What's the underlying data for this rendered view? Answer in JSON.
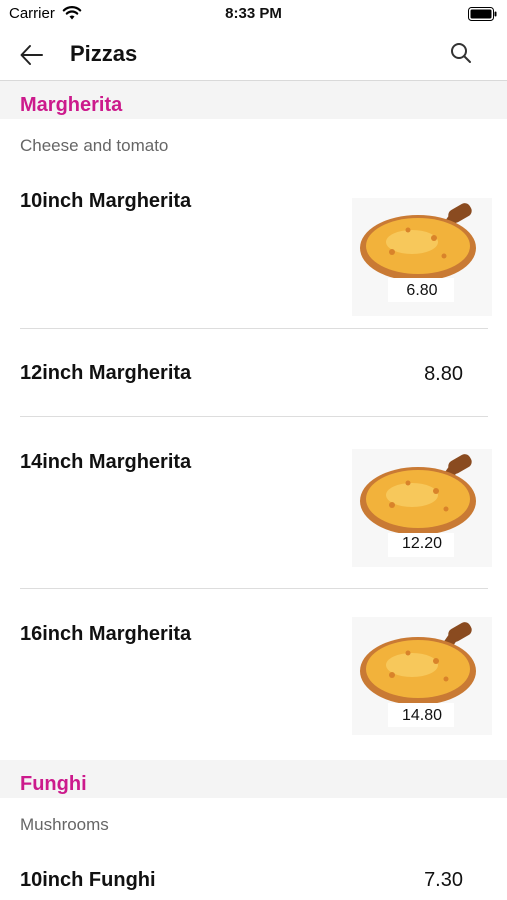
{
  "status_bar": {
    "carrier": "Carrier",
    "time": "8:33 PM"
  },
  "nav": {
    "title": "Pizzas"
  },
  "sections": [
    {
      "title": "Margherita",
      "description": "Cheese and tomato",
      "items": [
        {
          "name": "10inch Margherita",
          "price": "6.80",
          "has_image": true
        },
        {
          "name": "12inch Margherita",
          "price": "8.80",
          "has_image": false
        },
        {
          "name": "14inch Margherita",
          "price": "12.20",
          "has_image": true
        },
        {
          "name": "16inch Margherita",
          "price": "14.80",
          "has_image": true
        }
      ]
    },
    {
      "title": "Funghi",
      "description": "Mushrooms",
      "items": [
        {
          "name": "10inch Funghi",
          "price": "7.30",
          "has_image": false
        }
      ]
    }
  ],
  "colors": {
    "section_title": "#cc1a8c",
    "section_bg": "#f4f4f4",
    "divider": "#dddddd"
  },
  "icons": {
    "back": "arrow-left-icon",
    "search": "search-icon",
    "wifi": "wifi-icon",
    "battery": "battery-icon"
  }
}
